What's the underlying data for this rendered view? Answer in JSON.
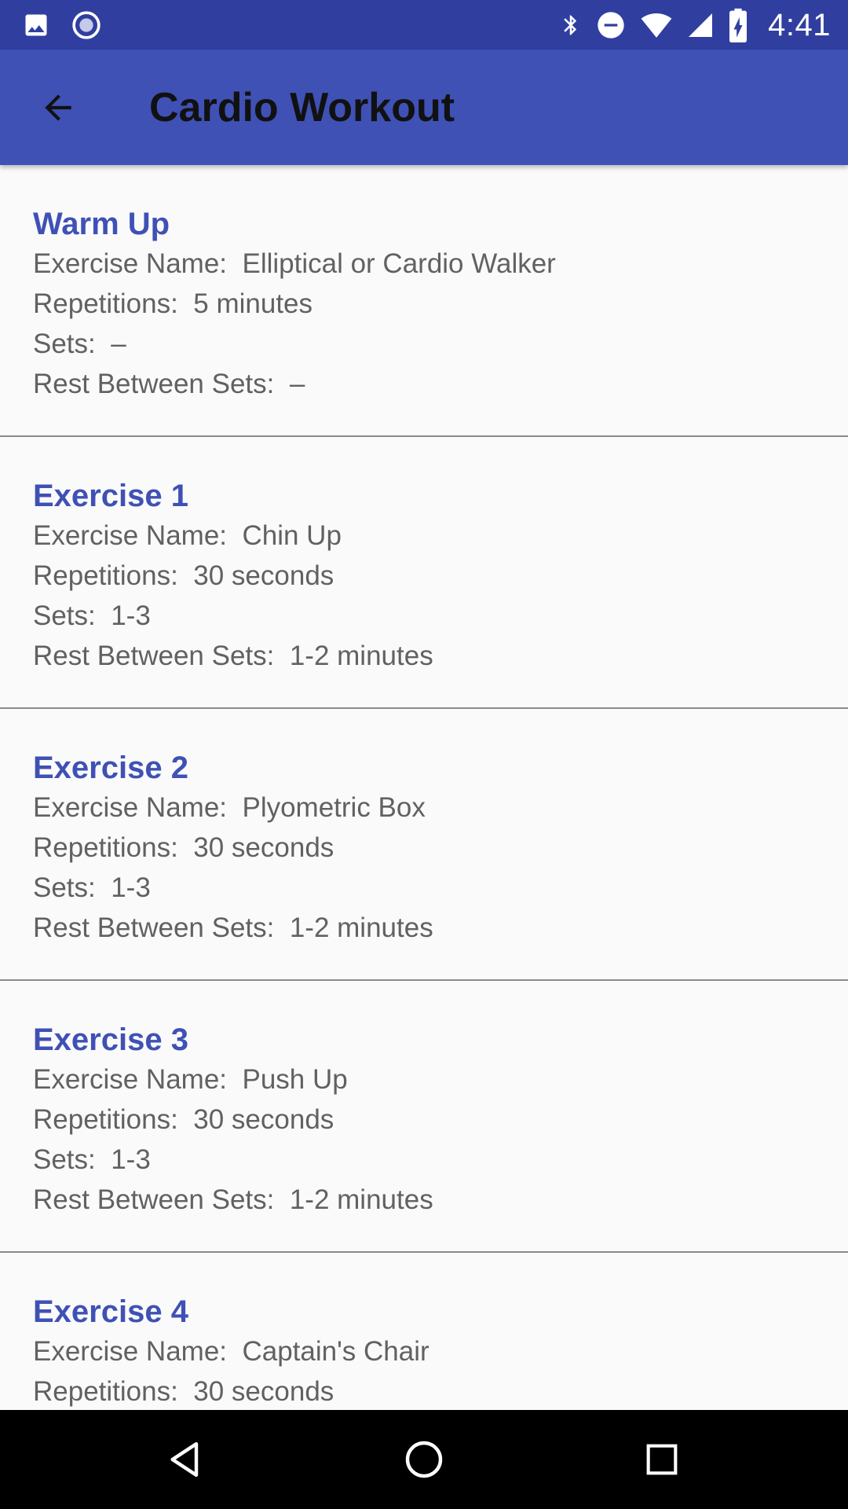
{
  "status_bar": {
    "time": "4:41",
    "icons": [
      "image-notification-icon",
      "assistant-notification-icon",
      "bluetooth-icon",
      "do-not-disturb-icon",
      "wifi-icon",
      "cell-signal-icon",
      "battery-charging-icon"
    ]
  },
  "app_bar": {
    "title": "Cardio Workout",
    "back_icon": "arrow-back-icon"
  },
  "labels": {
    "exercise_name": "Exercise Name:  ",
    "repetitions": "Repetitions:  ",
    "sets": "Sets:  ",
    "rest": "Rest Between Sets:  "
  },
  "exercises": [
    {
      "title": "Warm Up",
      "name": "Elliptical or Cardio Walker",
      "repetitions": "5 minutes",
      "sets": "–",
      "rest": "–"
    },
    {
      "title": "Exercise 1",
      "name": "Chin Up",
      "repetitions": "30 seconds",
      "sets": "1-3",
      "rest": "1-2 minutes"
    },
    {
      "title": "Exercise 2",
      "name": "Plyometric Box",
      "repetitions": "30 seconds",
      "sets": "1-3",
      "rest": "1-2 minutes"
    },
    {
      "title": "Exercise 3",
      "name": "Push Up",
      "repetitions": "30 seconds",
      "sets": "1-3",
      "rest": "1-2 minutes"
    },
    {
      "title": "Exercise 4",
      "name": "Captain's Chair",
      "repetitions": "30 seconds"
    }
  ],
  "nav_bar": {
    "icons": [
      "nav-back-icon",
      "nav-home-icon",
      "nav-recents-icon"
    ]
  },
  "colors": {
    "status_bar": "#303f9f",
    "app_bar": "#3f51b5",
    "title_accent": "#3f51b5",
    "body_text": "#616161",
    "background": "#fafafa",
    "nav_bar": "#000000"
  }
}
